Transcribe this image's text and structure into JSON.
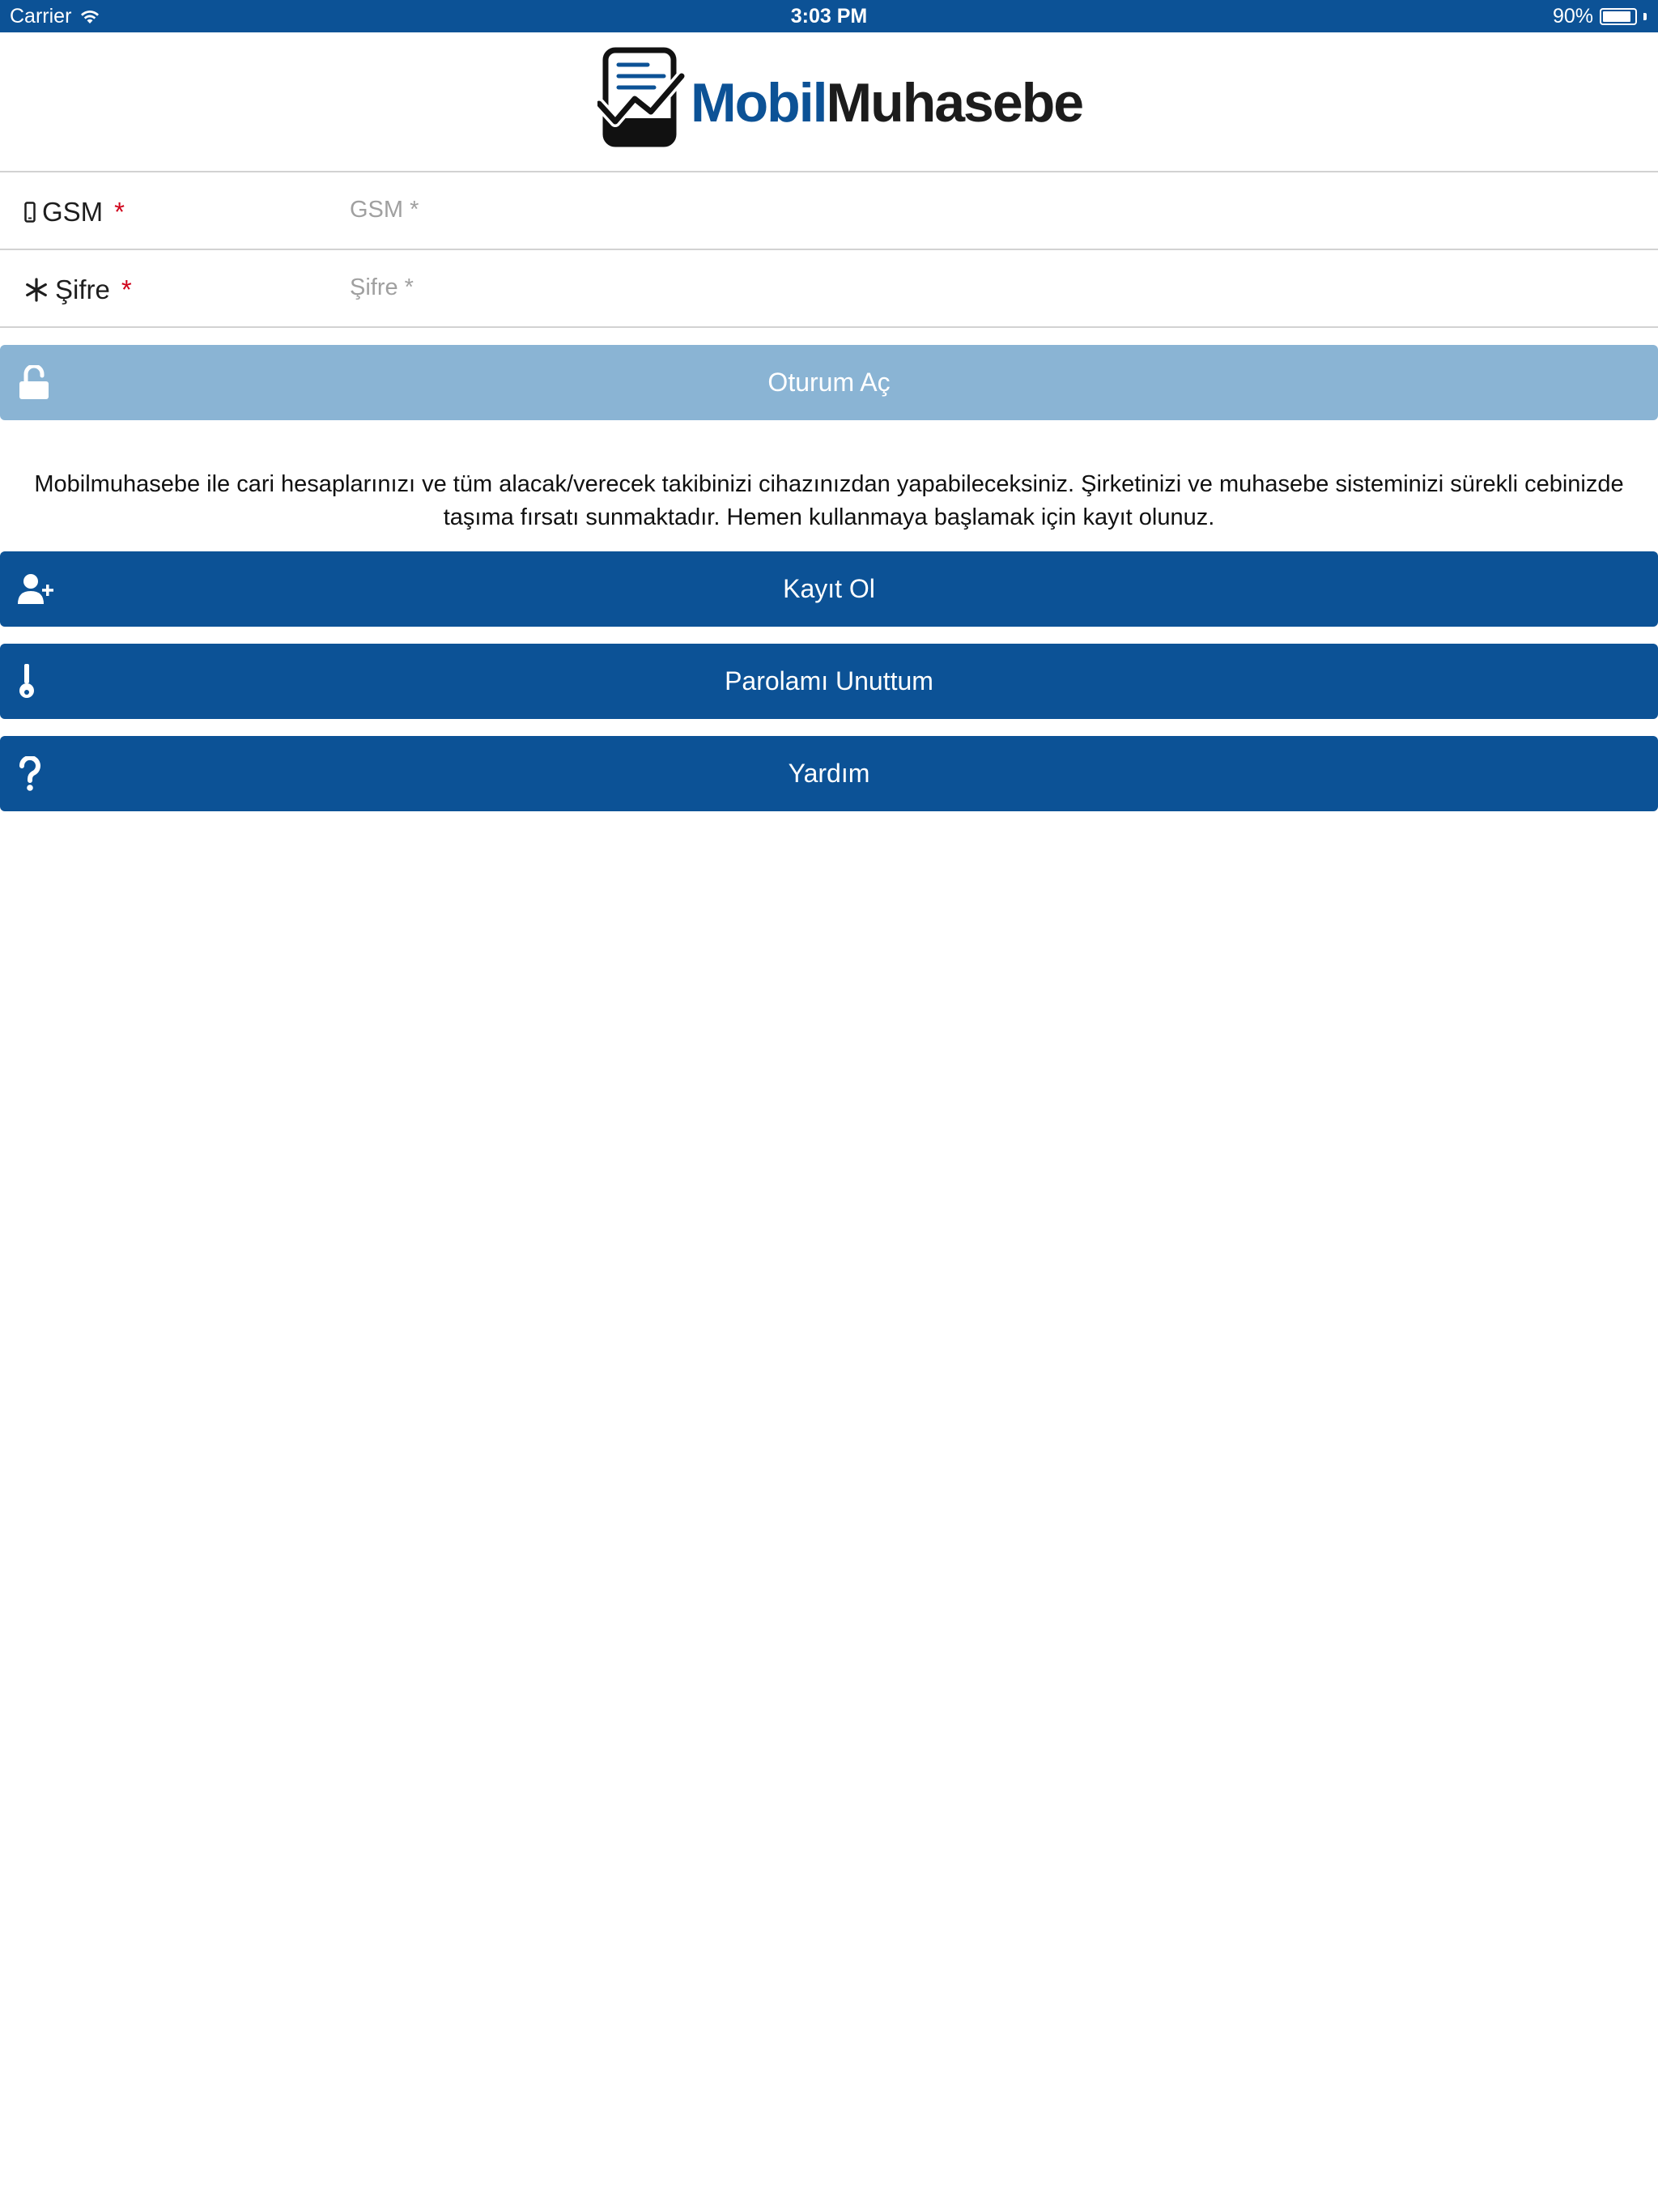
{
  "status_bar": {
    "carrier": "Carrier",
    "time": "3:03 PM",
    "battery": "90%",
    "battery_level": 0.9
  },
  "logo": {
    "part1": "Mobil",
    "part2": "Muhasebe"
  },
  "form": {
    "gsm": {
      "label": "GSM",
      "required_mark": "*",
      "placeholder": "GSM *",
      "value": ""
    },
    "password": {
      "label": "Şifre",
      "required_mark": "*",
      "placeholder": "Şifre *",
      "value": ""
    }
  },
  "buttons": {
    "login": "Oturum Aç",
    "register": "Kayıt Ol",
    "forgot": "Parolamı Unuttum",
    "help": "Yardım"
  },
  "description": "Mobilmuhasebe ile cari hesaplarınızı ve tüm alacak/verecek takibinizi cihazınızdan yapabileceksiniz. Şirketinizi ve muhasebe sisteminizi sürekli cebinizde taşıma fırsatı sunmaktadır. Hemen kullanmaya başlamak için kayıt olunuz.",
  "colors": {
    "primary": "#0c5296",
    "disabled_button": "#8ab4d4",
    "required": "#d0021b"
  }
}
